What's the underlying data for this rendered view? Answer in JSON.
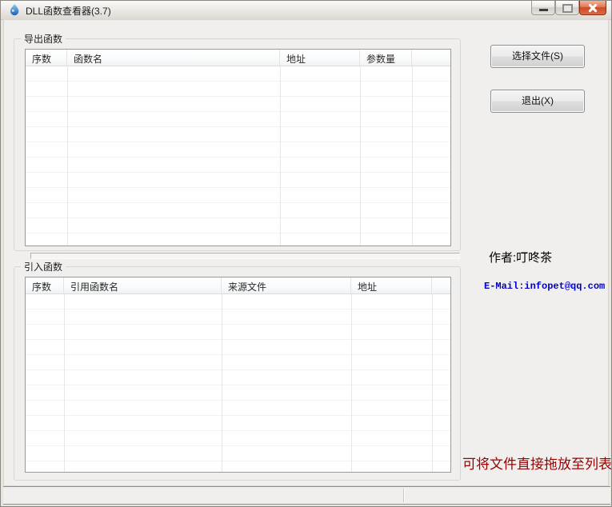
{
  "window": {
    "title": "DLL函数查看器(3.7)"
  },
  "export_section": {
    "label": "导出函数",
    "table": {
      "columns": [
        "序数",
        "函数名",
        "地址",
        "参数量",
        ""
      ],
      "rows": []
    }
  },
  "import_section": {
    "label": "引入函数",
    "table": {
      "columns": [
        "序数",
        "引用函数名",
        "来源文件",
        "地址",
        ""
      ],
      "rows": []
    }
  },
  "actions": {
    "select_file_button": "选择文件(S)",
    "exit_button": "退出(X)"
  },
  "info": {
    "author": "作者:叮咚茶",
    "email": "E-Mail:infopet@qq.com",
    "drop_hint": "可将文件直接拖放至列表"
  },
  "colors": {
    "window_bg": "#f0efee",
    "close_button": "#ce4a27",
    "email_text": "#0000c8",
    "hint_text": "#990000"
  }
}
